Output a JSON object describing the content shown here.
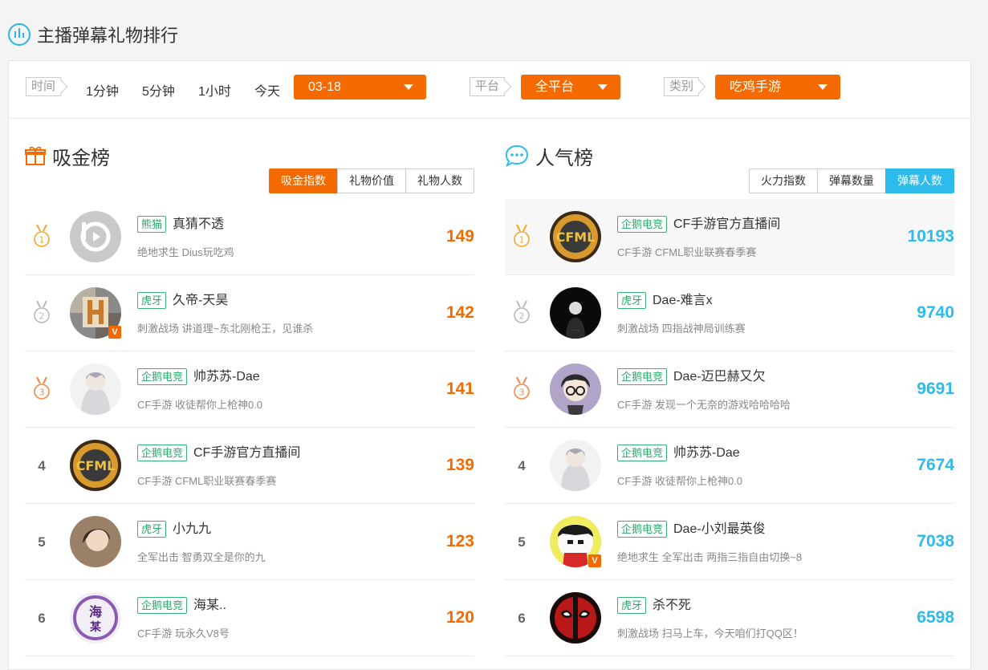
{
  "header": {
    "title": "主播弹幕礼物排行"
  },
  "filters": {
    "time_label": "时间",
    "time_options": [
      "1分钟",
      "5分钟",
      "1小时",
      "今天"
    ],
    "date_value": "03-18",
    "platform_label": "平台",
    "platform_value": "全平台",
    "category_label": "类别",
    "category_value": "吃鸡手游"
  },
  "left_board": {
    "title": "吸金榜",
    "tabs": [
      "吸金指数",
      "礼物价值",
      "礼物人数"
    ],
    "active_tab": "吸金指数",
    "rows": [
      {
        "rank": "1",
        "platform": "熊猫",
        "name": "真猜不透",
        "desc": "绝地求生 Dius玩吃鸡",
        "score": "149"
      },
      {
        "rank": "2",
        "platform": "虎牙",
        "name": "久帝-天昊",
        "desc": "刺激战场 讲道理~东北刚枪王，见谁杀",
        "score": "142"
      },
      {
        "rank": "3",
        "platform": "企鹅电竞",
        "name": "帅苏苏-Dae",
        "desc": "CF手游 收徒帮你上枪神0.0",
        "score": "141"
      },
      {
        "rank": "4",
        "platform": "企鹅电竞",
        "name": "CF手游官方直播间",
        "desc": "CF手游 CFML职业联赛春季赛",
        "score": "139"
      },
      {
        "rank": "5",
        "platform": "虎牙",
        "name": "小九九",
        "desc": "全军出击 智勇双全是你的九",
        "score": "123"
      },
      {
        "rank": "6",
        "platform": "企鹅电竞",
        "name": "海某..",
        "desc": "CF手游 玩永久V8号",
        "score": "120"
      }
    ]
  },
  "right_board": {
    "title": "人气榜",
    "tabs": [
      "火力指数",
      "弹幕数量",
      "弹幕人数"
    ],
    "active_tab": "弹幕人数",
    "rows": [
      {
        "rank": "1",
        "platform": "企鹅电竞",
        "name": "CF手游官方直播间",
        "desc": "CF手游 CFML职业联赛春季赛",
        "score": "10193"
      },
      {
        "rank": "2",
        "platform": "虎牙",
        "name": "Dae-难言x",
        "desc": "刺激战场 四指战神局训练赛",
        "score": "9740"
      },
      {
        "rank": "3",
        "platform": "企鹅电竞",
        "name": "Dae-迈巴赫又欠",
        "desc": "CF手游 发现一个无奈的游戏哈哈哈哈",
        "score": "9691"
      },
      {
        "rank": "4",
        "platform": "企鹅电竞",
        "name": "帅苏苏-Dae",
        "desc": "CF手游 收徒帮你上枪神0.0",
        "score": "7674"
      },
      {
        "rank": "5",
        "platform": "企鹅电竞",
        "name": "Dae-小刘最英俊",
        "desc": "绝地求生 全军出击 两指三指自由切换~8",
        "score": "7038"
      },
      {
        "rank": "6",
        "platform": "虎牙",
        "name": "杀不死",
        "desc": "刺激战场 扫马上车，今天咱们打QQ区！",
        "score": "6598"
      }
    ]
  },
  "badge_text": "V",
  "colors": {
    "accent_orange": "#f56a00",
    "accent_blue": "#2cbbea",
    "platform_green": "#35b477",
    "medal_gold": "#f0a830"
  }
}
